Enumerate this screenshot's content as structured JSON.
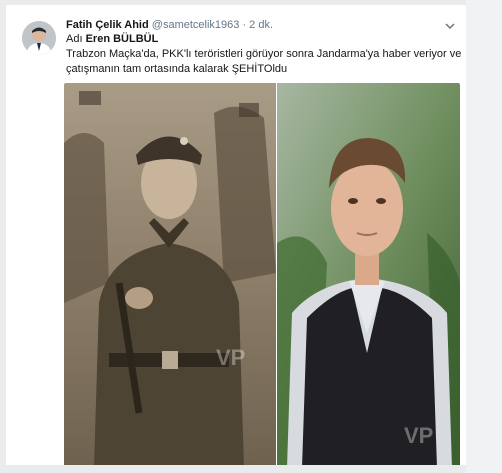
{
  "tweet": {
    "author_name": "Fatih Çelik Ahid",
    "handle": "@sametcelik1963",
    "separator": " · ",
    "time": "2 dk.",
    "line1_prefix": "Adı ",
    "line1_name": "Eren BÜLBÜL",
    "line2": "Trabzon Maçka'da, PKK'lı teröristleri görüyor sonra Jandarma'ya haber veriyor ve",
    "line3": "çatışmanın tam ortasında kalarak ŞEHİTOldu"
  },
  "media": {
    "watermark_left": "VP",
    "watermark_right": "VP"
  },
  "icons": {
    "menu": "chevron-down-icon",
    "avatar": "avatar"
  },
  "colors": {
    "name": "#14171a",
    "meta": "#657786",
    "background": "#e9ebec"
  }
}
